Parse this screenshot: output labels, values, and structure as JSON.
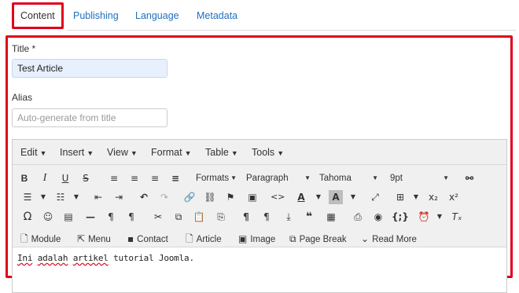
{
  "tabs": [
    {
      "label": "Content",
      "active": true
    },
    {
      "label": "Publishing"
    },
    {
      "label": "Language"
    },
    {
      "label": "Metadata"
    }
  ],
  "form": {
    "title_label": "Title *",
    "title_value": "Test Article",
    "alias_label": "Alias",
    "alias_placeholder": "Auto-generate from title"
  },
  "editor": {
    "menus": [
      "Edit",
      "Insert",
      "View",
      "Format",
      "Table",
      "Tools"
    ],
    "formats_label": "Formats",
    "block_label": "Paragraph",
    "font_label": "Tahoma",
    "size_label": "9pt",
    "buttons": [
      "Module",
      "Menu",
      "Contact",
      "Article",
      "Image",
      "Page Break",
      "Read More"
    ],
    "content_words": [
      "Ini",
      "adalah",
      "artikel",
      "tutorial Joomla."
    ]
  },
  "colors": {
    "accent": "#1f6fbf",
    "highlight_border": "#e0001b",
    "field_fill": "#e8f0fd"
  }
}
